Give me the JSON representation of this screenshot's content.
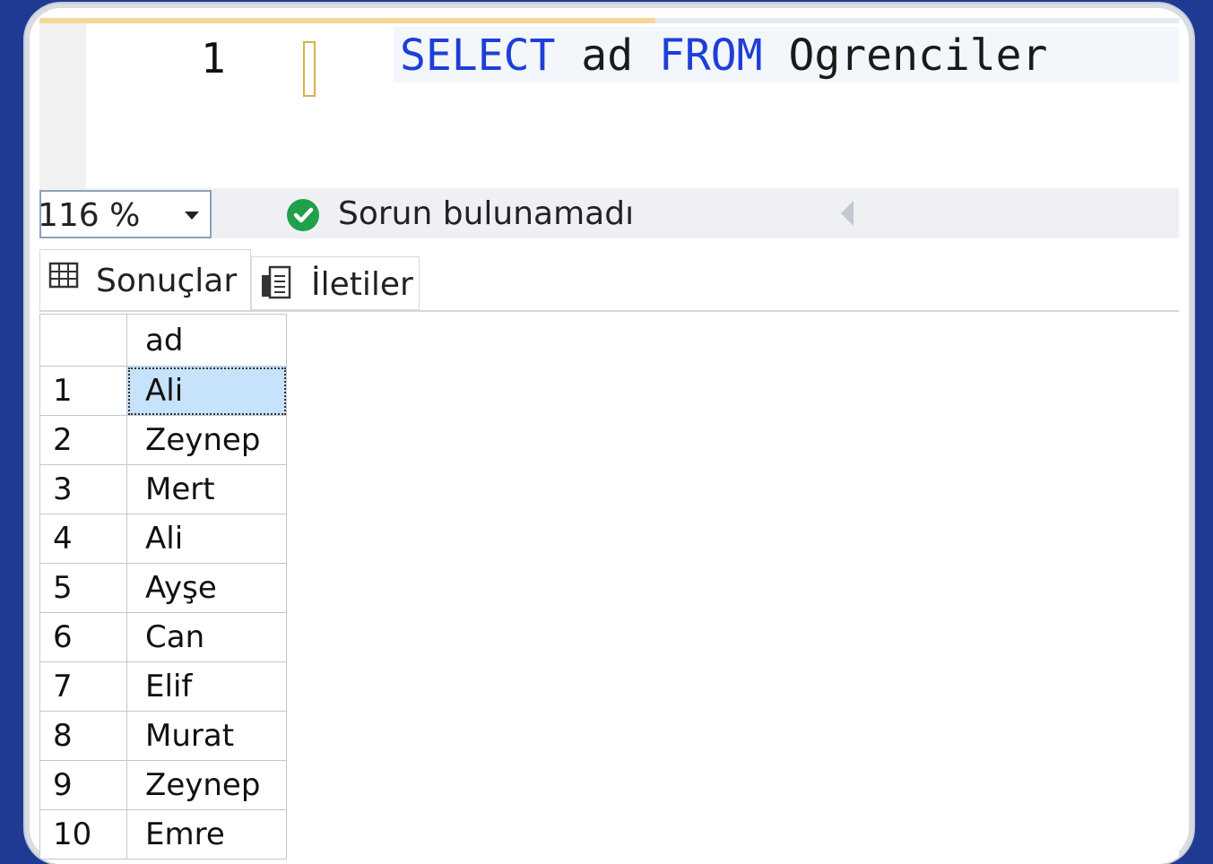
{
  "editor": {
    "line_number": "1",
    "code_tokens": [
      {
        "text": "SELECT",
        "kind": "keyword"
      },
      {
        "text": " ad ",
        "kind": "identifier"
      },
      {
        "text": "FROM",
        "kind": "keyword"
      },
      {
        "text": " Ogrenciler",
        "kind": "identifier"
      }
    ]
  },
  "status": {
    "zoom": "116 %",
    "message": "Sorun bulunamadı",
    "ok_icon": "check-circle-icon",
    "ok_color": "#20a04b"
  },
  "tabs": [
    {
      "label": "Sonuçlar",
      "icon": "grid-icon",
      "active": true
    },
    {
      "label": "İletiler",
      "icon": "messages-icon",
      "active": false
    }
  ],
  "results": {
    "columns": [
      "",
      "ad"
    ],
    "rows": [
      [
        "1",
        "Ali"
      ],
      [
        "2",
        "Zeynep"
      ],
      [
        "3",
        "Mert"
      ],
      [
        "4",
        "Ali"
      ],
      [
        "5",
        "Ayşe"
      ],
      [
        "6",
        "Can"
      ],
      [
        "7",
        "Elif"
      ],
      [
        "8",
        "Murat"
      ],
      [
        "9",
        "Zeynep"
      ],
      [
        "10",
        "Emre"
      ]
    ],
    "selected_row": 0
  },
  "colors": {
    "keyword": "#1d3fd8",
    "background": "#1f3a93",
    "selection": "#c7e2fb"
  }
}
